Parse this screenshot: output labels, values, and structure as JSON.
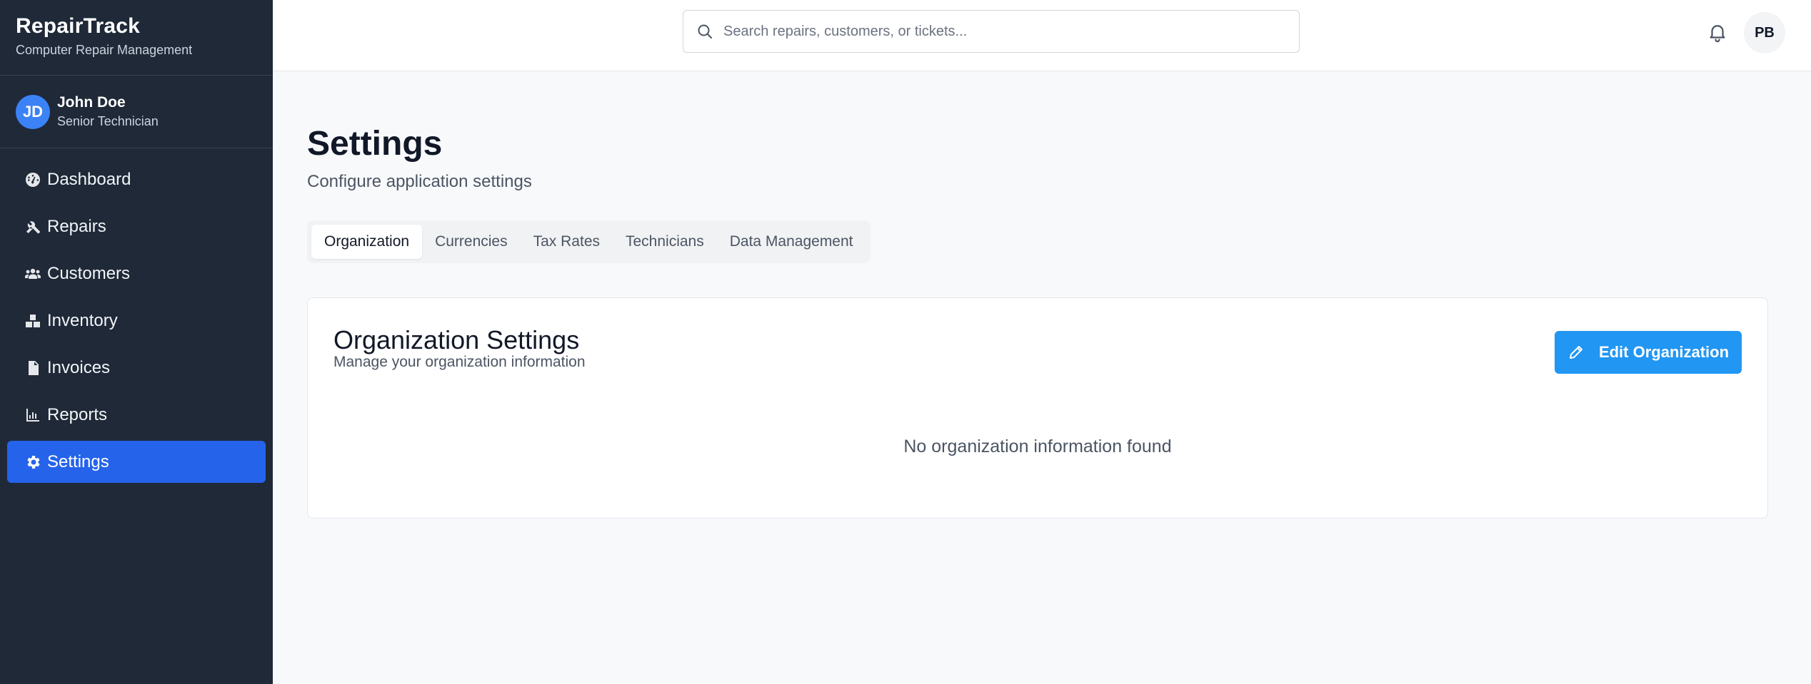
{
  "brand": {
    "title": "RepairTrack",
    "subtitle": "Computer Repair Management"
  },
  "user": {
    "initials": "JD",
    "name": "John Doe",
    "role": "Senior Technician"
  },
  "nav": [
    {
      "label": "Dashboard",
      "icon": "dashboard-icon"
    },
    {
      "label": "Repairs",
      "icon": "tools-icon"
    },
    {
      "label": "Customers",
      "icon": "users-icon"
    },
    {
      "label": "Inventory",
      "icon": "boxes-icon"
    },
    {
      "label": "Invoices",
      "icon": "invoice-icon"
    },
    {
      "label": "Reports",
      "icon": "chart-icon"
    },
    {
      "label": "Settings",
      "icon": "gear-icon",
      "active": true
    }
  ],
  "header": {
    "search_placeholder": "Search repairs, customers, or tickets...",
    "profile_initials": "PB"
  },
  "page": {
    "title": "Settings",
    "subtitle": "Configure application settings"
  },
  "tabs": [
    {
      "label": "Organization",
      "active": true
    },
    {
      "label": "Currencies"
    },
    {
      "label": "Tax Rates"
    },
    {
      "label": "Technicians"
    },
    {
      "label": "Data Management"
    }
  ],
  "card": {
    "title": "Organization Settings",
    "subtitle": "Manage your organization information",
    "edit_label": "Edit Organization",
    "empty_text": "No organization information found"
  },
  "colors": {
    "sidebar": "#1f2937",
    "accent": "#2563eb",
    "button": "#2196f3"
  }
}
